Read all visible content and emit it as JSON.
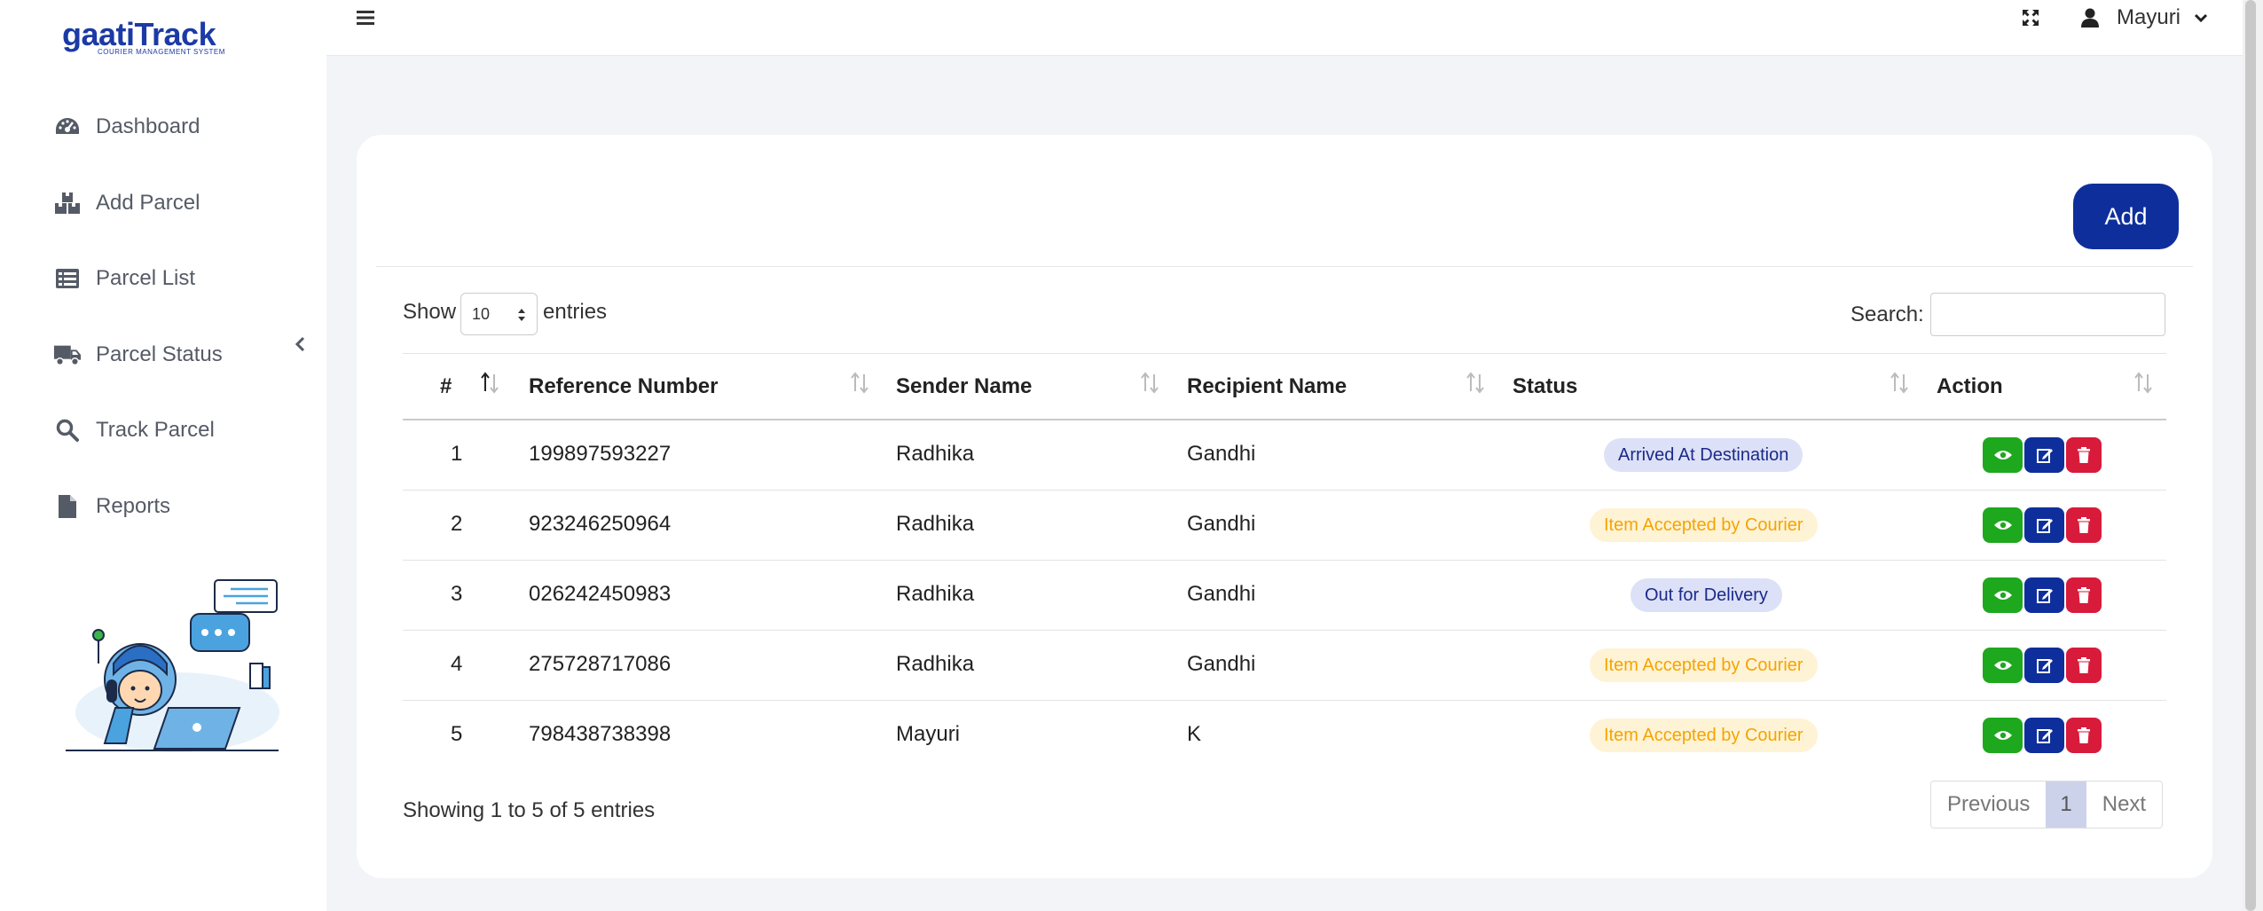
{
  "brand": {
    "name": "gaatiTrack",
    "tagline": "COURIER MANAGEMENT SYSTEM"
  },
  "sidebar": {
    "items": [
      {
        "label": "Dashboard",
        "icon": "dashboard-gauge-icon"
      },
      {
        "label": "Add Parcel",
        "icon": "boxes-icon"
      },
      {
        "label": "Parcel List",
        "icon": "list-icon"
      },
      {
        "label": "Parcel Status",
        "icon": "truck-icon"
      },
      {
        "label": "Track Parcel",
        "icon": "search-icon"
      },
      {
        "label": "Reports",
        "icon": "file-icon"
      }
    ]
  },
  "header": {
    "user_name": "Mayuri"
  },
  "toolbar": {
    "add_label": "Add"
  },
  "table_controls": {
    "show_label": "Show",
    "entries_value": "10",
    "entries_label": "entries",
    "search_label": "Search:",
    "search_value": ""
  },
  "table": {
    "columns": [
      "#",
      "Reference Number",
      "Sender Name",
      "Recipient Name",
      "Status",
      "Action"
    ],
    "rows": [
      {
        "num": "1",
        "ref": "199897593227",
        "sender": "Radhika",
        "recipient": "Gandhi",
        "status": "Arrived At Destination",
        "status_color": "blue"
      },
      {
        "num": "2",
        "ref": "923246250964",
        "sender": "Radhika",
        "recipient": "Gandhi",
        "status": "Item Accepted by Courier",
        "status_color": "yellow"
      },
      {
        "num": "3",
        "ref": "026242450983",
        "sender": "Radhika",
        "recipient": "Gandhi",
        "status": "Out for Delivery",
        "status_color": "blue"
      },
      {
        "num": "4",
        "ref": "275728717086",
        "sender": "Radhika",
        "recipient": "Gandhi",
        "status": "Item Accepted by Courier",
        "status_color": "yellow"
      },
      {
        "num": "5",
        "ref": "798438738398",
        "sender": "Mayuri",
        "recipient": "K",
        "status": "Item Accepted by Courier",
        "status_color": "yellow"
      }
    ]
  },
  "footer": {
    "info": "Showing 1 to 5 of 5 entries",
    "previous": "Previous",
    "page": "1",
    "next": "Next"
  },
  "colors": {
    "primary": "#0e2f9b",
    "view": "#1ea81e",
    "delete": "#d81b3b",
    "badge_blue_bg": "#dde1f7",
    "badge_yellow_bg": "#fff3d6"
  }
}
